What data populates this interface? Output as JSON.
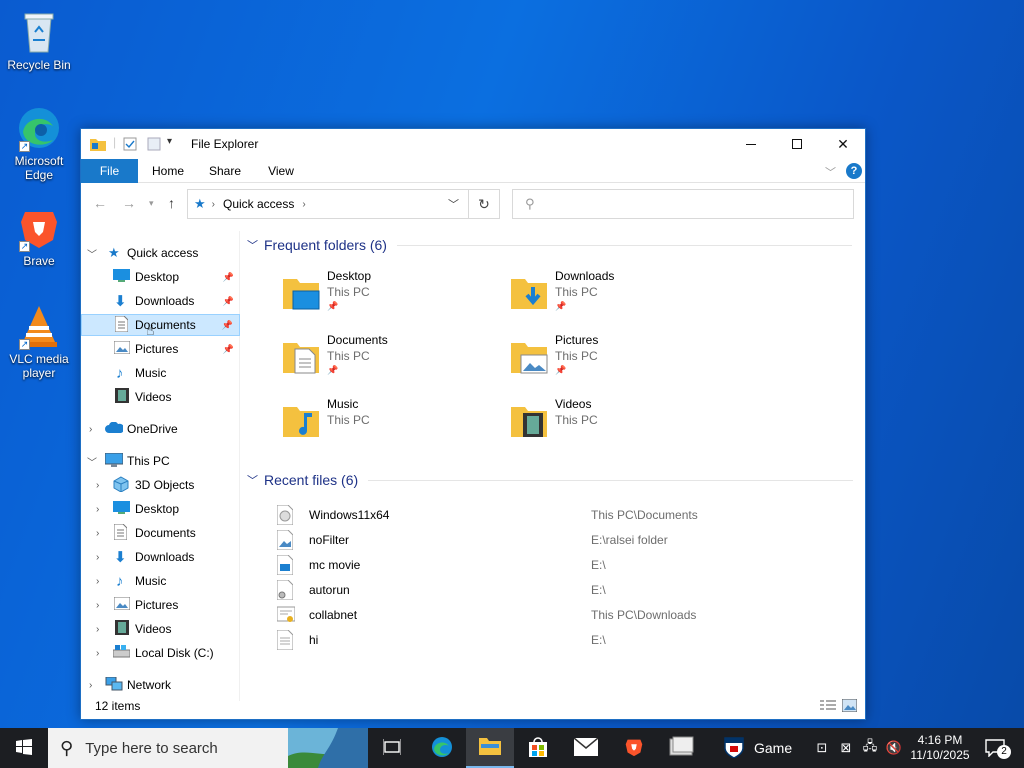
{
  "desktop_icons": [
    {
      "label": "Recycle Bin",
      "icon": "recycle-bin-icon"
    },
    {
      "label": "Microsoft Edge",
      "icon": "edge-icon"
    },
    {
      "label": "Brave",
      "icon": "brave-icon"
    },
    {
      "label": "VLC media player",
      "icon": "vlc-icon"
    }
  ],
  "window": {
    "title": "File Explorer",
    "accent": "#1979ca",
    "ribbon": {
      "file": "File",
      "home": "Home",
      "share": "Share",
      "view": "View"
    },
    "address": {
      "location": "Quick access"
    },
    "status_items": "12 items"
  },
  "nav": {
    "quick_access": "Quick access",
    "quick_items": [
      {
        "label": "Desktop"
      },
      {
        "label": "Downloads"
      },
      {
        "label": "Documents"
      },
      {
        "label": "Pictures"
      },
      {
        "label": "Music"
      },
      {
        "label": "Videos"
      }
    ],
    "onedrive": "OneDrive",
    "this_pc": "This PC",
    "pc_items": [
      {
        "label": "3D Objects"
      },
      {
        "label": "Desktop"
      },
      {
        "label": "Documents"
      },
      {
        "label": "Downloads"
      },
      {
        "label": "Music"
      },
      {
        "label": "Pictures"
      },
      {
        "label": "Videos"
      },
      {
        "label": "Local Disk (C:)"
      }
    ],
    "network": "Network"
  },
  "frequent": {
    "heading": "Frequent folders (6)",
    "folders": [
      {
        "name": "Desktop",
        "location": "This PC",
        "pinned": true
      },
      {
        "name": "Downloads",
        "location": "This PC",
        "pinned": true
      },
      {
        "name": "Documents",
        "location": "This PC",
        "pinned": true
      },
      {
        "name": "Pictures",
        "location": "This PC",
        "pinned": true
      },
      {
        "name": "Music",
        "location": "This PC",
        "pinned": false
      },
      {
        "name": "Videos",
        "location": "This PC",
        "pinned": false
      }
    ]
  },
  "recent": {
    "heading": "Recent files (6)",
    "files": [
      {
        "name": "Windows11x64",
        "path": "This PC\\Documents"
      },
      {
        "name": "noFilter",
        "path": "E:\\ralsei folder"
      },
      {
        "name": "mc movie",
        "path": "E:\\"
      },
      {
        "name": "autorun",
        "path": "E:\\"
      },
      {
        "name": "collabnet",
        "path": "This PC\\Downloads"
      },
      {
        "name": "hi",
        "path": "E:\\"
      }
    ]
  },
  "taskbar": {
    "search_placeholder": "Type here to search",
    "game_label": "Game",
    "time": "4:16 PM",
    "date": "11/10/2025",
    "notification_count": "2"
  }
}
